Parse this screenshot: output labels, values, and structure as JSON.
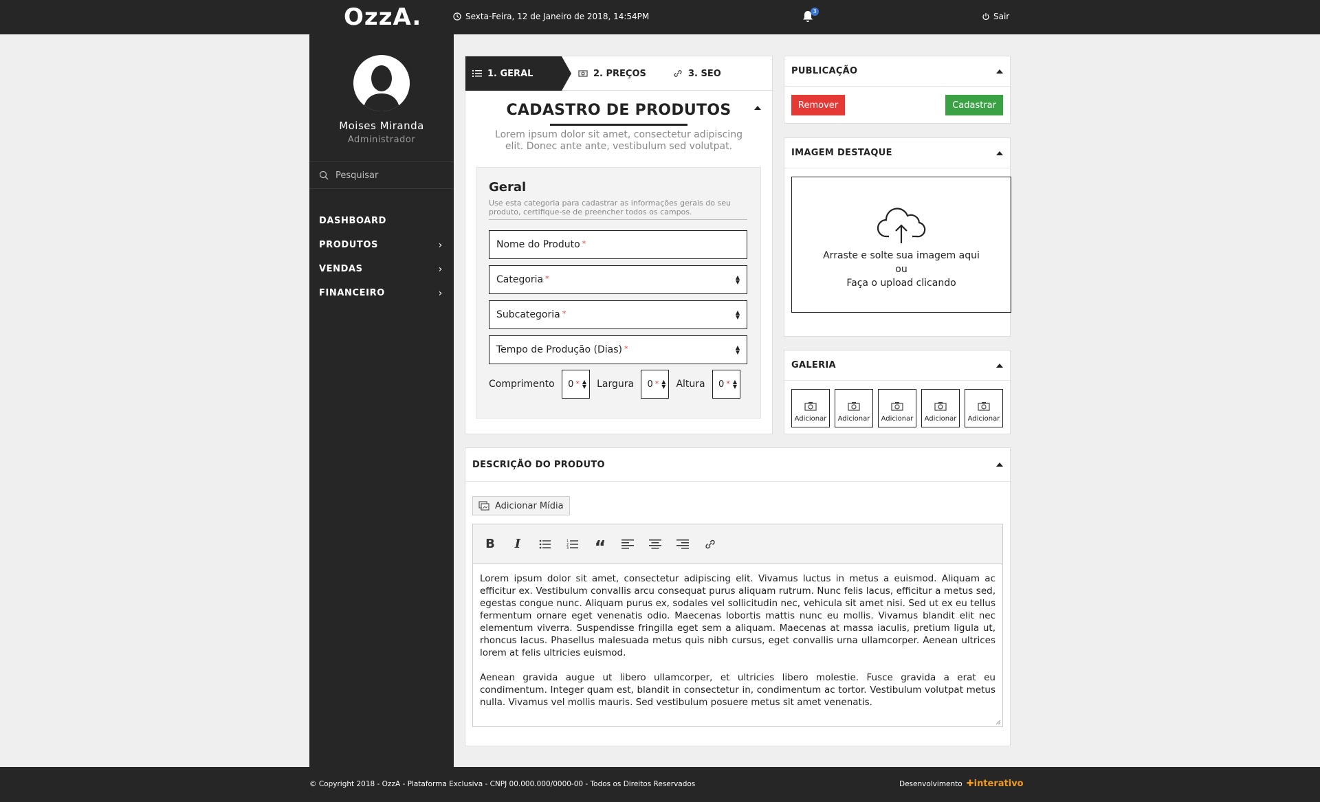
{
  "header": {
    "logo": "OzzA.",
    "datetime": "Sexta-Feira, 12 de Janeiro de 2018, 14:54PM",
    "notifications_count": "3",
    "logout_label": "Sair"
  },
  "sidebar": {
    "user_name": "Moises Miranda",
    "user_role": "Administrador",
    "search_placeholder": "Pesquisar",
    "items": [
      {
        "label": "DASHBOARD",
        "has_children": false
      },
      {
        "label": "PRODUTOS",
        "has_children": true
      },
      {
        "label": "VENDAS",
        "has_children": true
      },
      {
        "label": "FINANCEIRO",
        "has_children": true
      }
    ]
  },
  "tabs": [
    {
      "label": "1. GERAL",
      "icon": "list-icon",
      "active": true
    },
    {
      "label": "2. PREÇOS",
      "icon": "money-icon",
      "active": false
    },
    {
      "label": "3. SEO",
      "icon": "link-icon",
      "active": false
    }
  ],
  "form": {
    "title": "CADASTRO DE PRODUTOS",
    "description": "Lorem ipsum dolor sit amet, consectetur adipiscing elit. Donec ante ante, vestibulum sed volutpat.",
    "section_title": "Geral",
    "section_desc": "Use esta categoria para cadastrar as informações gerais do seu produto, certifique-se de preencher todos os campos.",
    "fields": {
      "product_name": "Nome do Produto",
      "category": "Categoria",
      "subcategory": "Subcategoria",
      "production_time": "Tempo de Produção (Dias)",
      "required_mark": "*"
    },
    "dimensions": {
      "length_label": "Comprimento",
      "length_value": "0",
      "width_label": "Largura",
      "width_value": "0",
      "height_label": "Altura",
      "height_value": "0"
    }
  },
  "publication": {
    "title": "PUBLICAÇÃO",
    "remove_label": "Remover",
    "submit_label": "Cadastrar"
  },
  "featured_image": {
    "title": "IMAGEM DESTAQUE",
    "line1": "Arraste e solte sua imagem aqui",
    "line2": "ou",
    "line3": "Faça o upload clicando"
  },
  "gallery": {
    "title": "GALERIA",
    "items": [
      "Adicionar",
      "Adicionar",
      "Adicionar",
      "Adicionar",
      "Adicionar"
    ]
  },
  "description": {
    "title": "DESCRIÇÃO DO PRODUTO",
    "add_media_label": "Adicionar Mídia",
    "paragraphs": [
      "Lorem ipsum dolor sit amet, consectetur adipiscing elit. Vivamus luctus in metus a euismod. Aliquam ac efficitur ex. Vestibulum convallis arcu consequat purus aliquam rutrum. Nunc felis lacus, efficitur a metus sed, egestas congue nunc. Aliquam purus ex, sodales vel sollicitudin nec, vehicula sit amet nisi. Sed ut ex eu tellus fermentum ornare eget venenatis odio. Maecenas lobortis mattis nunc eu mollis. Vivamus blandit elit nec elementum viverra. Suspendisse fringilla eget sem a aliquam. Maecenas at massa iaculis, pretium ligula ut, rhoncus lacus. Phasellus malesuada metus quis nibh cursus, eget convallis urna ullamcorper. Aenean ultrices lorem at felis ultricies euismod.",
      "Aenean gravida augue ut libero ullamcorper, et ultricies libero molestie. Fusce gravida a erat eu condimentum. Integer quam est, blandit in consectetur in, condimentum ac tortor. Vestibulum volutpat metus nulla. Vivamus vel mollis mauris. Sed vestibulum posuere metus sit amet venenatis."
    ]
  },
  "footer": {
    "copyright": "© Copyright 2018 - OzzA - Plataforma Exclusiva - CNPJ 00.000.000/0000-00 - Todos os Direitos Reservados",
    "dev_label": "Desenvolvimento",
    "dev_brand": "interativo"
  },
  "colors": {
    "dark": "#262626",
    "red": "#e53935",
    "green": "#3aa245",
    "badge": "#3b74d6",
    "brand_orange": "#f29a1f"
  }
}
